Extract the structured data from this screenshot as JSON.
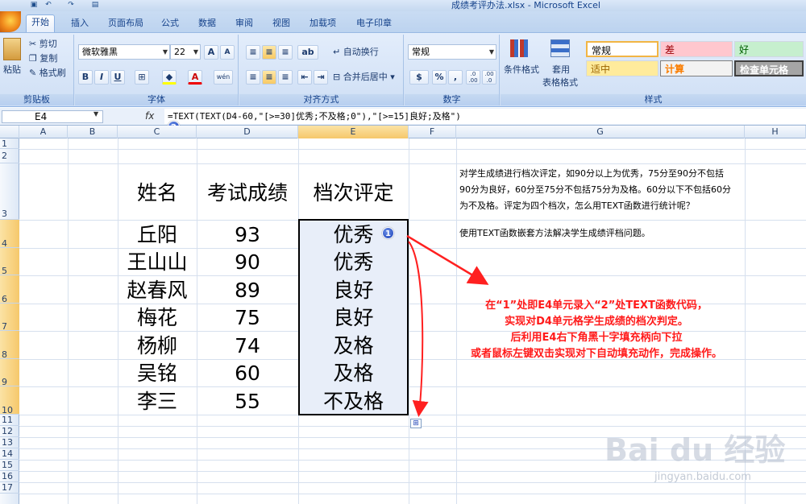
{
  "window": {
    "title": "成绩考评办法.xlsx - Microsoft Excel"
  },
  "tabs": [
    "开始",
    "插入",
    "页面布局",
    "公式",
    "数据",
    "审阅",
    "视图",
    "加载项",
    "电子印章"
  ],
  "ribbon": {
    "clipboard": {
      "paste": "粘贴",
      "cut": "剪切",
      "copy": "复制",
      "format_painter": "格式刷",
      "label": "剪贴板"
    },
    "font": {
      "name": "微软雅黑",
      "size": "22",
      "bold": "B",
      "italic": "I",
      "underline": "U",
      "grow": "A",
      "shrink": "A",
      "phonetic": "wén",
      "label": "字体"
    },
    "alignment": {
      "wrap": "自动换行",
      "merge": "合并后居中",
      "label": "对齐方式"
    },
    "number": {
      "format": "常规",
      "percent": "%",
      "comma": ",",
      "dec_inc": ".0 .00",
      "dec_dec": ".00 .0",
      "label": "数字"
    },
    "styles": {
      "cond_format": "条件格式",
      "table_format_1": "套用",
      "table_format_2": "表格格式",
      "normal": "常规",
      "bad": "差",
      "good": "好",
      "neutral": "适中",
      "calc": "计算",
      "check": "检查单元格",
      "label": "样式"
    }
  },
  "formula_bar": {
    "name_box": "E4",
    "fx": "fx",
    "formula": "=TEXT(TEXT(D4-60,\"[>=30]优秀;不及格;0\"),\"[>=15]良好;及格\")"
  },
  "columns": [
    "A",
    "B",
    "C",
    "D",
    "E",
    "F",
    "G",
    "H"
  ],
  "rows": [
    "1",
    "2",
    "3",
    "4",
    "5",
    "6",
    "7",
    "8",
    "9",
    "10",
    "11",
    "12",
    "13",
    "14",
    "15",
    "16",
    "17"
  ],
  "table": {
    "headers": [
      "姓名",
      "考试成绩",
      "档次评定"
    ],
    "names": [
      "丘阳",
      "王山山",
      "赵春风",
      "梅花",
      "杨柳",
      "吴铭",
      "李三"
    ],
    "scores": [
      "93",
      "90",
      "89",
      "75",
      "74",
      "60",
      "55"
    ],
    "grades": [
      "优秀",
      "优秀",
      "良好",
      "良好",
      "及格",
      "及格",
      "不及格"
    ]
  },
  "description": {
    "line1": "对学生成绩进行档次评定，如90分以上为优秀，75分至90分不包括",
    "line2": "90分为良好，60分至75分不包括75分为及格。60分以下不包括60分",
    "line3": "为不及格。评定为四个档次，怎么用TEXT函数进行统计呢？",
    "line4": "使用TEXT函数嵌套方法解决学生成绩评档问题。"
  },
  "annotation": {
    "line1": "在“1”处即E4单元录入“2”处TEXT函数代码，",
    "line2": "实现对D4单元格学生成绩的档次判定。",
    "line3": "后利用E4右下角黑十字填充柄向下拉",
    "line4": "或者鼠标左键双击实现对下自动填充动作，完成操作。"
  },
  "markers": {
    "m1": "1",
    "m2": "2"
  },
  "watermark": {
    "main": "Bai du 经验",
    "url": "jingyan.baidu.com"
  },
  "colors": {
    "accent": "#15428b",
    "annotation": "#ff1a1a",
    "selection": "#e8eef9"
  }
}
